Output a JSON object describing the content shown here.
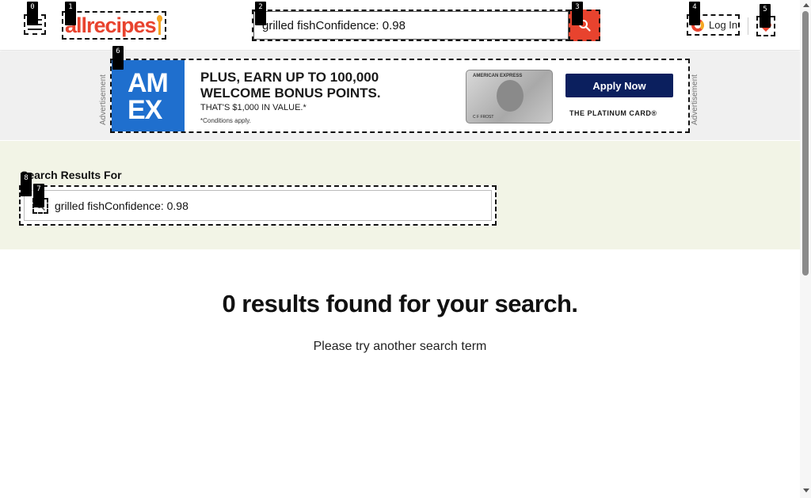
{
  "header": {
    "logo_text": "allrecipes",
    "search": {
      "value": "grilled fishConfidence: 0.98",
      "placeholder": ""
    },
    "login_label": "Log In"
  },
  "advertisement": {
    "side_label": "Advertisement",
    "brand": "AM EX",
    "headline": "PLUS, EARN UP TO 100,000 WELCOME BONUS POINTS.",
    "subline": "THAT'S $1,000 IN VALUE.*",
    "fine_print": "*Conditions apply.",
    "card_issuer": "AMERICAN EXPRESS",
    "card_holder": "C F FROST",
    "cta_label": "Apply Now",
    "card_name": "THE PLATINUM CARD®"
  },
  "results": {
    "label": "Search Results For",
    "query": "grilled fishConfidence: 0.98"
  },
  "empty_state": {
    "title": "0 results found for your search.",
    "subtitle": "Please try another search term"
  },
  "markers": [
    "0",
    "1",
    "2",
    "3",
    "4",
    "5",
    "6",
    "7",
    "8"
  ],
  "colors": {
    "brand": "#e8432e",
    "accent": "#f5a623",
    "results_band": "#f2f4e6",
    "ad_band": "#f0f0f0",
    "amex_blue": "#1f6fce",
    "cta_navy": "#0b1f5e"
  }
}
